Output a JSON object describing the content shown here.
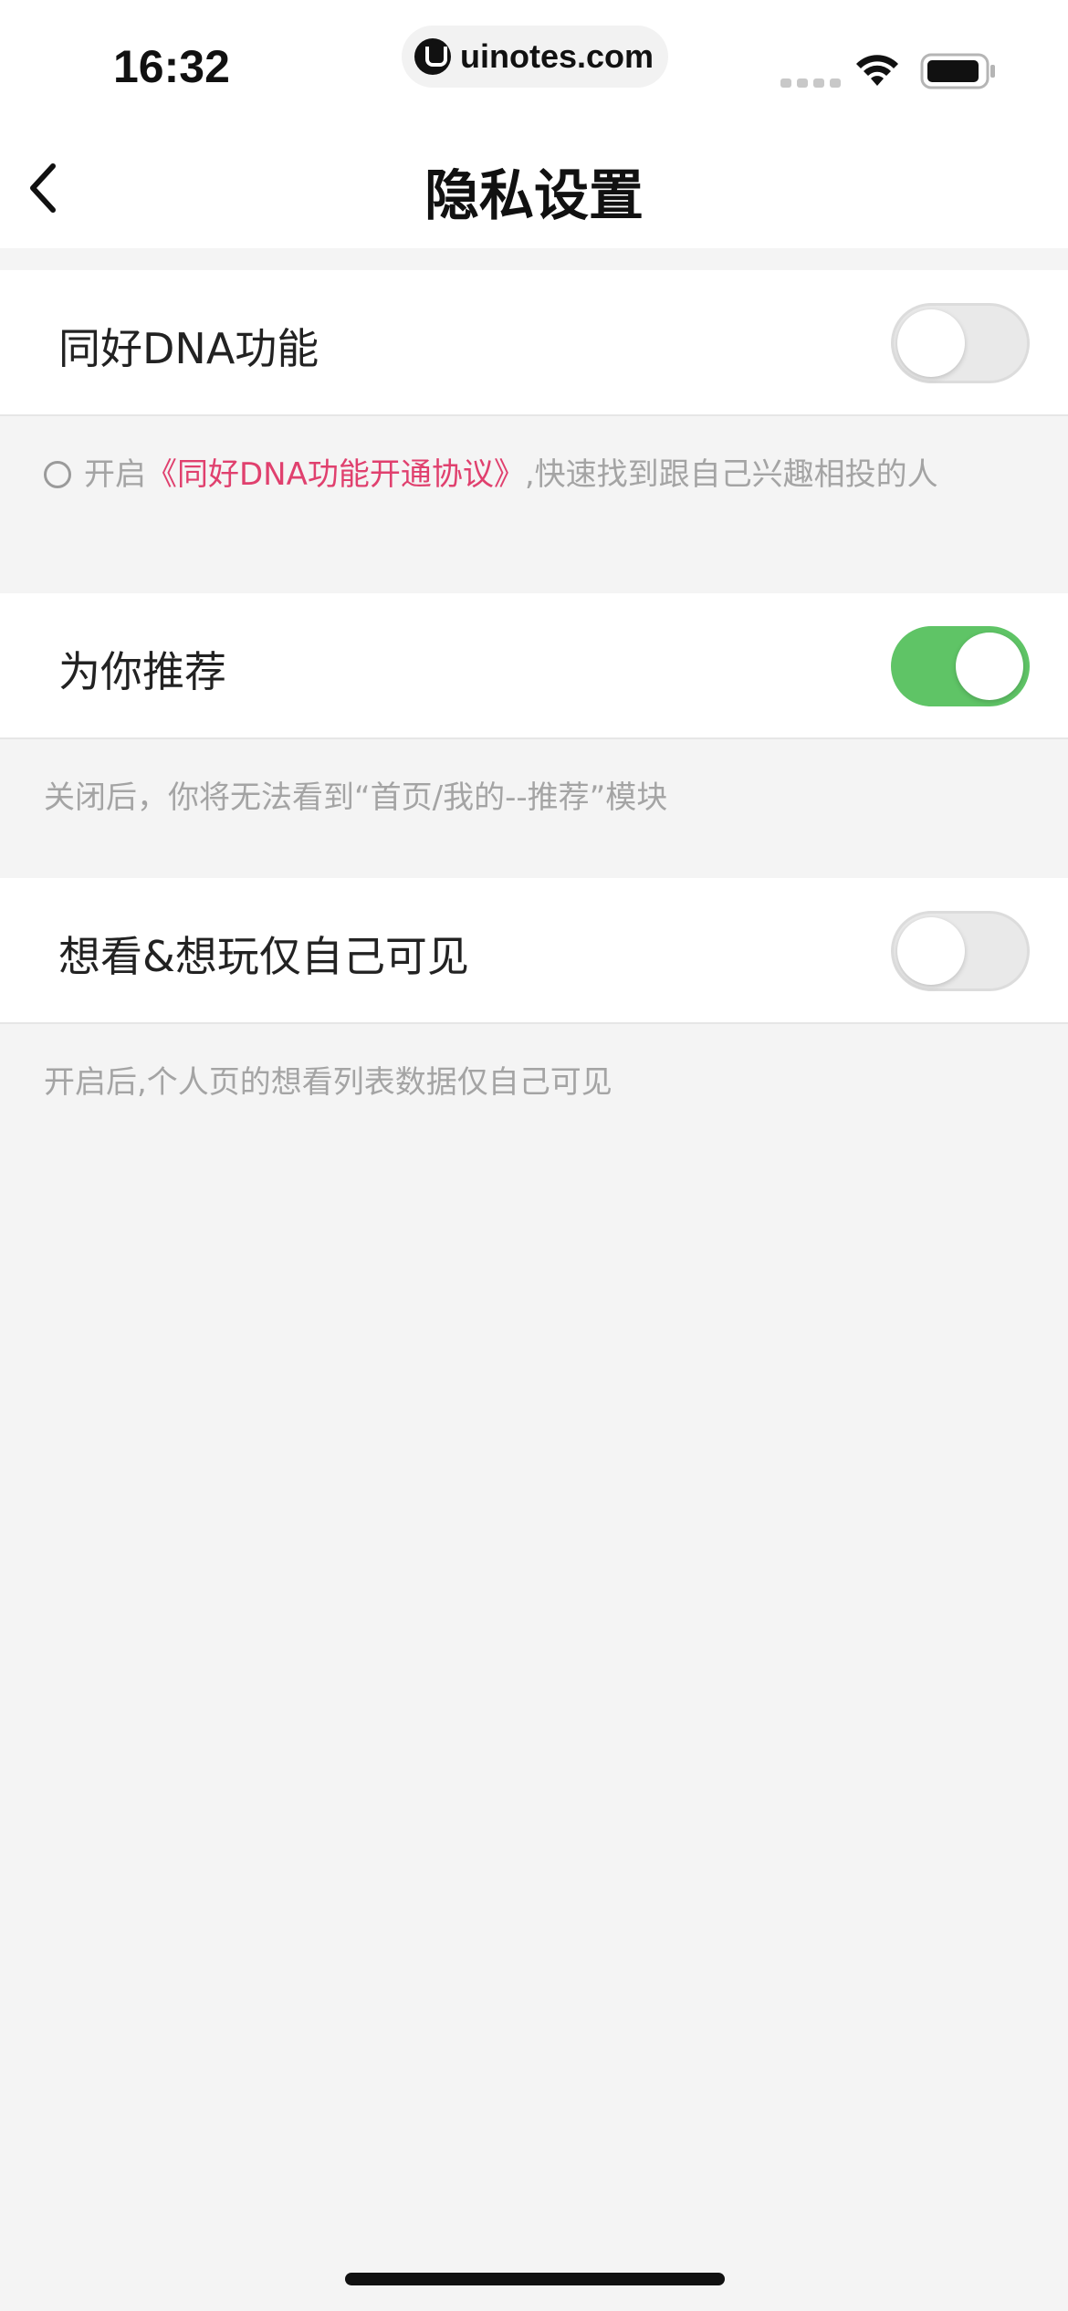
{
  "status_bar": {
    "time": "16:32",
    "watermark": "uinotes.com"
  },
  "nav": {
    "title": "隐私设置"
  },
  "settings": [
    {
      "label": "同好DNA功能",
      "enabled": false,
      "description": {
        "prefix": "开启",
        "link": "《同好DNA功能开通协议》",
        "suffix": ",快速找到跟自己兴趣相投的人"
      }
    },
    {
      "label": "为你推荐",
      "enabled": true,
      "description": "关闭后，你将无法看到“首页/我的--推荐”模块"
    },
    {
      "label": "想看&想玩仅自己可见",
      "enabled": false,
      "description": "开启后,个人页的想看列表数据仅自己可见"
    }
  ],
  "colors": {
    "toggle_on": "#5fc466",
    "link": "#e0406e",
    "background": "#f4f4f4"
  }
}
